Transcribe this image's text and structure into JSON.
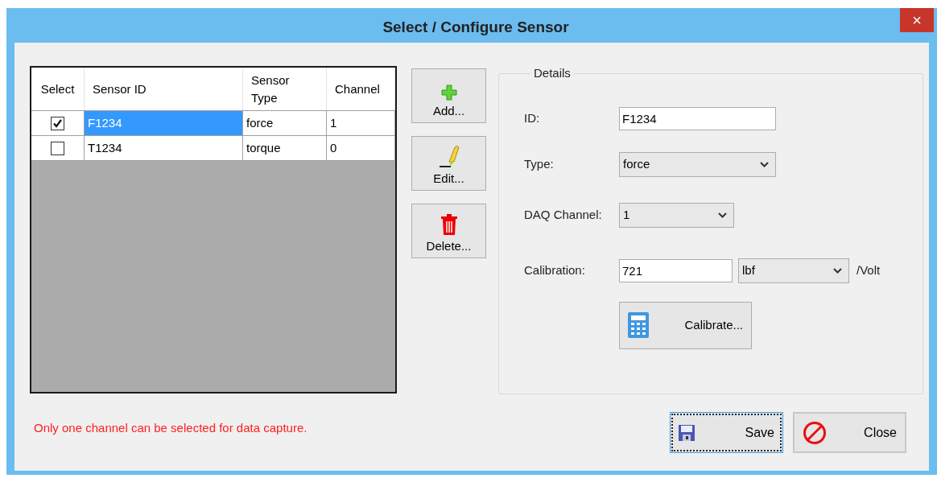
{
  "window": {
    "title": "Select / Configure Sensor",
    "close_glyph": "×"
  },
  "table": {
    "columns": [
      "Select",
      "Sensor ID",
      "Sensor Type",
      "Channel"
    ],
    "rows": [
      {
        "checked": true,
        "selected": true,
        "sensor_id": "F1234",
        "sensor_type": "force",
        "channel": "1"
      },
      {
        "checked": false,
        "selected": false,
        "sensor_id": "T1234",
        "sensor_type": "torque",
        "channel": "0"
      }
    ]
  },
  "actions": [
    {
      "kind": "add",
      "label": "Add..."
    },
    {
      "kind": "edit",
      "label": "Edit..."
    },
    {
      "kind": "delete",
      "label": "Delete..."
    }
  ],
  "details": {
    "title": "Details",
    "fields": [
      {
        "kind": "text",
        "label": "ID:",
        "value": "F1234"
      },
      {
        "kind": "select",
        "label": "Type:",
        "value": "force"
      },
      {
        "kind": "select_short",
        "label": "DAQ Channel:",
        "value": "1"
      },
      {
        "kind": "calibration",
        "label": "Calibration:",
        "value": "721",
        "unit": "lbf",
        "per": "/Volt"
      }
    ],
    "calibrate_button": "Calibrate..."
  },
  "message": "Only one channel can be selected for data capture.",
  "buttons": [
    {
      "kind": "save",
      "label": "Save",
      "focused": true
    },
    {
      "kind": "close",
      "label": "Close",
      "focused": false
    }
  ]
}
